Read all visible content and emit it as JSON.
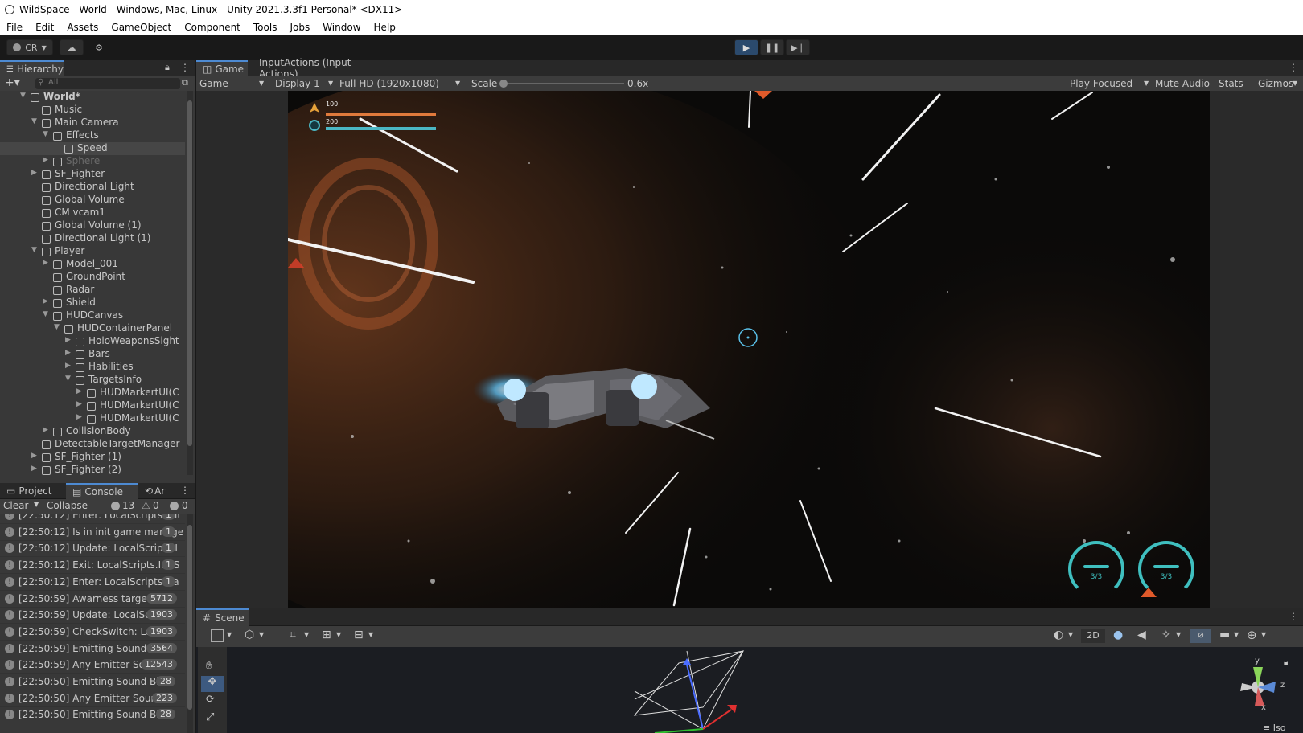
{
  "window": {
    "title": "WildSpace - World - Windows, Mac, Linux - Unity 2021.3.3f1 Personal* <DX11>"
  },
  "menu": [
    "File",
    "Edit",
    "Assets",
    "GameObject",
    "Component",
    "Tools",
    "Jobs",
    "Window",
    "Help"
  ],
  "toolbar": {
    "account": "CR"
  },
  "hierarchy": {
    "tab": "Hierarchy",
    "search_placeholder": "All",
    "items": [
      {
        "label": "World*",
        "depth": 0,
        "arrow": "▼",
        "bold": true
      },
      {
        "label": "Music",
        "depth": 1
      },
      {
        "label": "Main Camera",
        "depth": 1,
        "arrow": "▼"
      },
      {
        "label": "Effects",
        "depth": 2,
        "arrow": "▼"
      },
      {
        "label": "Speed",
        "depth": 3,
        "selected": true
      },
      {
        "label": "Sphere",
        "depth": 2,
        "arrow": "▶",
        "dim": true
      },
      {
        "label": "SF_Fighter",
        "depth": 1,
        "arrow": "▶"
      },
      {
        "label": "Directional Light",
        "depth": 1
      },
      {
        "label": "Global Volume",
        "depth": 1
      },
      {
        "label": "CM vcam1",
        "depth": 1
      },
      {
        "label": "Global Volume (1)",
        "depth": 1
      },
      {
        "label": "Directional Light (1)",
        "depth": 1
      },
      {
        "label": "Player",
        "depth": 1,
        "arrow": "▼"
      },
      {
        "label": "Model_001",
        "depth": 2,
        "arrow": "▶"
      },
      {
        "label": "GroundPoint",
        "depth": 2
      },
      {
        "label": "Radar",
        "depth": 2
      },
      {
        "label": "Shield",
        "depth": 2,
        "arrow": "▶"
      },
      {
        "label": "HUDCanvas",
        "depth": 2,
        "arrow": "▼"
      },
      {
        "label": "HUDContainerPanel",
        "depth": 3,
        "arrow": "▼"
      },
      {
        "label": "HoloWeaponsSight",
        "depth": 4,
        "arrow": "▶"
      },
      {
        "label": "Bars",
        "depth": 4,
        "arrow": "▶"
      },
      {
        "label": "Habilities",
        "depth": 4,
        "arrow": "▶"
      },
      {
        "label": "TargetsInfo",
        "depth": 4,
        "arrow": "▼"
      },
      {
        "label": "HUDMarkertUI(C",
        "depth": 5,
        "arrow": "▶"
      },
      {
        "label": "HUDMarkertUI(C",
        "depth": 5,
        "arrow": "▶"
      },
      {
        "label": "HUDMarkertUI(C",
        "depth": 5,
        "arrow": "▶"
      },
      {
        "label": "CollisionBody",
        "depth": 2,
        "arrow": "▶"
      },
      {
        "label": "DetectableTargetManager",
        "depth": 1
      },
      {
        "label": "SF_Fighter (1)",
        "depth": 1,
        "arrow": "▶"
      },
      {
        "label": "SF_Fighter (2)",
        "depth": 1,
        "arrow": "▶"
      }
    ]
  },
  "bottom_tabs": {
    "project": "Project",
    "console": "Console",
    "third": "Ar"
  },
  "console": {
    "clear": "Clear",
    "collapse": "Collapse",
    "log_count": "13",
    "warn_count": "0",
    "error_count": "0",
    "rows": [
      {
        "msg": "[22:50:12] Enter: LocalScripts.Init",
        "cnt": "1"
      },
      {
        "msg": "[22:50:12] Is in init game manage",
        "cnt": "1"
      },
      {
        "msg": "[22:50:12] Update: LocalScripts.I",
        "cnt": "1"
      },
      {
        "msg": "[22:50:12] Exit: LocalScripts.InitS",
        "cnt": "1"
      },
      {
        "msg": "[22:50:12] Enter: LocalScripts.Ga",
        "cnt": "1"
      },
      {
        "msg": "[22:50:59] Awarness targets",
        "cnt": "5712"
      },
      {
        "msg": "[22:50:59] Update: LocalScri",
        "cnt": "1903"
      },
      {
        "msg": "[22:50:59] CheckSwitch: Loc",
        "cnt": "1903"
      },
      {
        "msg": "[22:50:59] Emitting Sound Te",
        "cnt": "3564"
      },
      {
        "msg": "[22:50:59] Any Emitter Sour",
        "cnt": "12543"
      },
      {
        "msg": "[22:50:50] Emitting Sound Blast",
        "cnt": "28"
      },
      {
        "msg": "[22:50:50] Any Emitter Sound",
        "cnt": "223"
      },
      {
        "msg": "[22:50:50] Emitting Sound Blast",
        "cnt": "28"
      }
    ]
  },
  "game": {
    "tab": "Game",
    "tab2": "InputActions (Input Actions)",
    "mode": "Game",
    "display": "Display 1",
    "resolution": "Full HD (1920x1080)",
    "scale_label": "Scale",
    "scale_value": "0.6x",
    "play_focused": "Play Focused",
    "mute": "Mute Audio",
    "stats": "Stats",
    "gizmos": "Gizmos",
    "hud": {
      "health": "100",
      "shield": "200",
      "ability1": "3/3",
      "ability2": "3/3"
    }
  },
  "scene": {
    "tab": "Scene",
    "mode_2d": "2D",
    "iso": "Iso",
    "gizmo_y": "y",
    "gizmo_z": "z",
    "gizmo_x": "x"
  },
  "colors": {
    "accent": "#4d8ad2",
    "health": "#e07a3c",
    "shield": "#4bb7c4",
    "hud_cyan": "#3fbfbf"
  }
}
